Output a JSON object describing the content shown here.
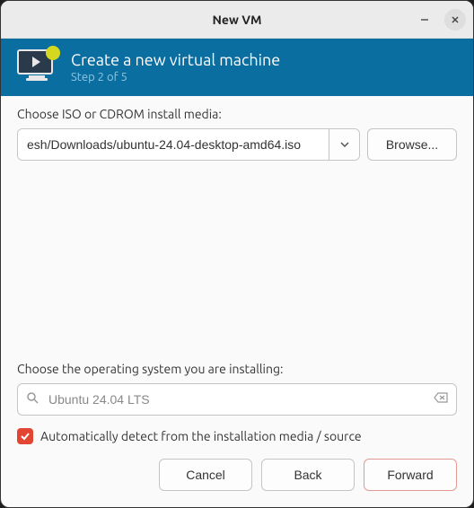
{
  "window": {
    "title": "New VM"
  },
  "banner": {
    "title": "Create a new virtual machine",
    "step": "Step 2 of 5"
  },
  "media": {
    "label": "Choose ISO or CDROM install media:",
    "value": "esh/Downloads/ubuntu-24.04-desktop-amd64.iso",
    "browse": "Browse..."
  },
  "os": {
    "label": "Choose the operating system you are installing:",
    "value": "Ubuntu 24.04 LTS",
    "autodetect_checked": true,
    "autodetect_label": "Automatically detect from the installation media / source"
  },
  "footer": {
    "cancel": "Cancel",
    "back": "Back",
    "forward": "Forward"
  }
}
